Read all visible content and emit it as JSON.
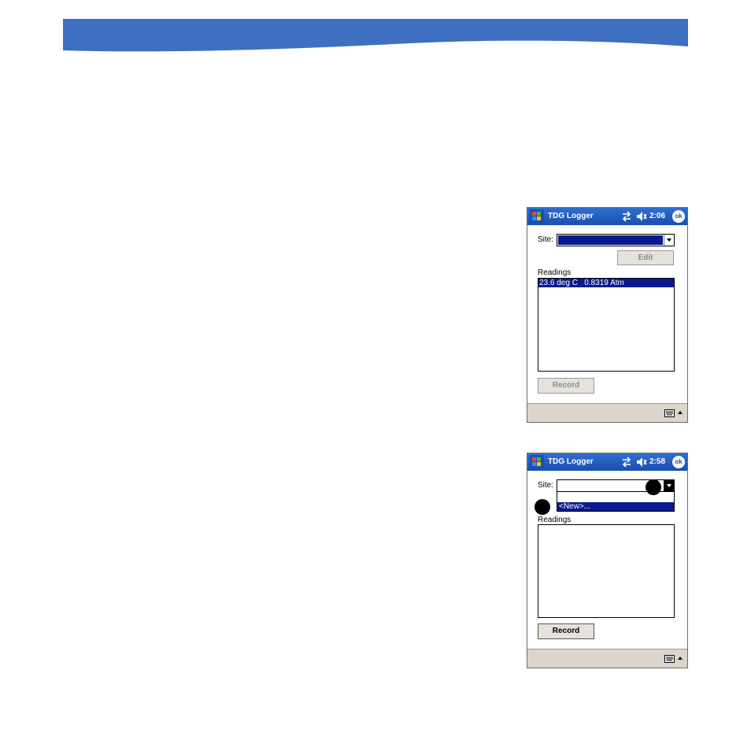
{
  "colors": {
    "banner_blue": "#3f6fc1",
    "title_bar": "#1a4fb0",
    "selection": "#0a1a8c",
    "menubar": "#dcd5cb"
  },
  "screens": [
    {
      "title": "TDG Logger",
      "time": "2:06",
      "ok": "ok",
      "site_label": "Site:",
      "edit_button": "Edit",
      "readings_label": "Readings",
      "readings": [
        "23.6 deg C   0.8319 Atm"
      ],
      "record_button": "Record",
      "icons": [
        "windows-start-icon",
        "connectivity-icon",
        "volume-muted-icon",
        "keyboard-icon",
        "chevron-up-icon"
      ]
    },
    {
      "title": "TDG Logger",
      "time": "2:58",
      "ok": "ok",
      "site_label": "Site:",
      "dropdown_option": "<New>...",
      "readings_label": "Readings",
      "record_button": "Record",
      "icons": [
        "windows-start-icon",
        "connectivity-icon",
        "volume-muted-icon",
        "keyboard-icon",
        "chevron-up-icon"
      ]
    }
  ]
}
